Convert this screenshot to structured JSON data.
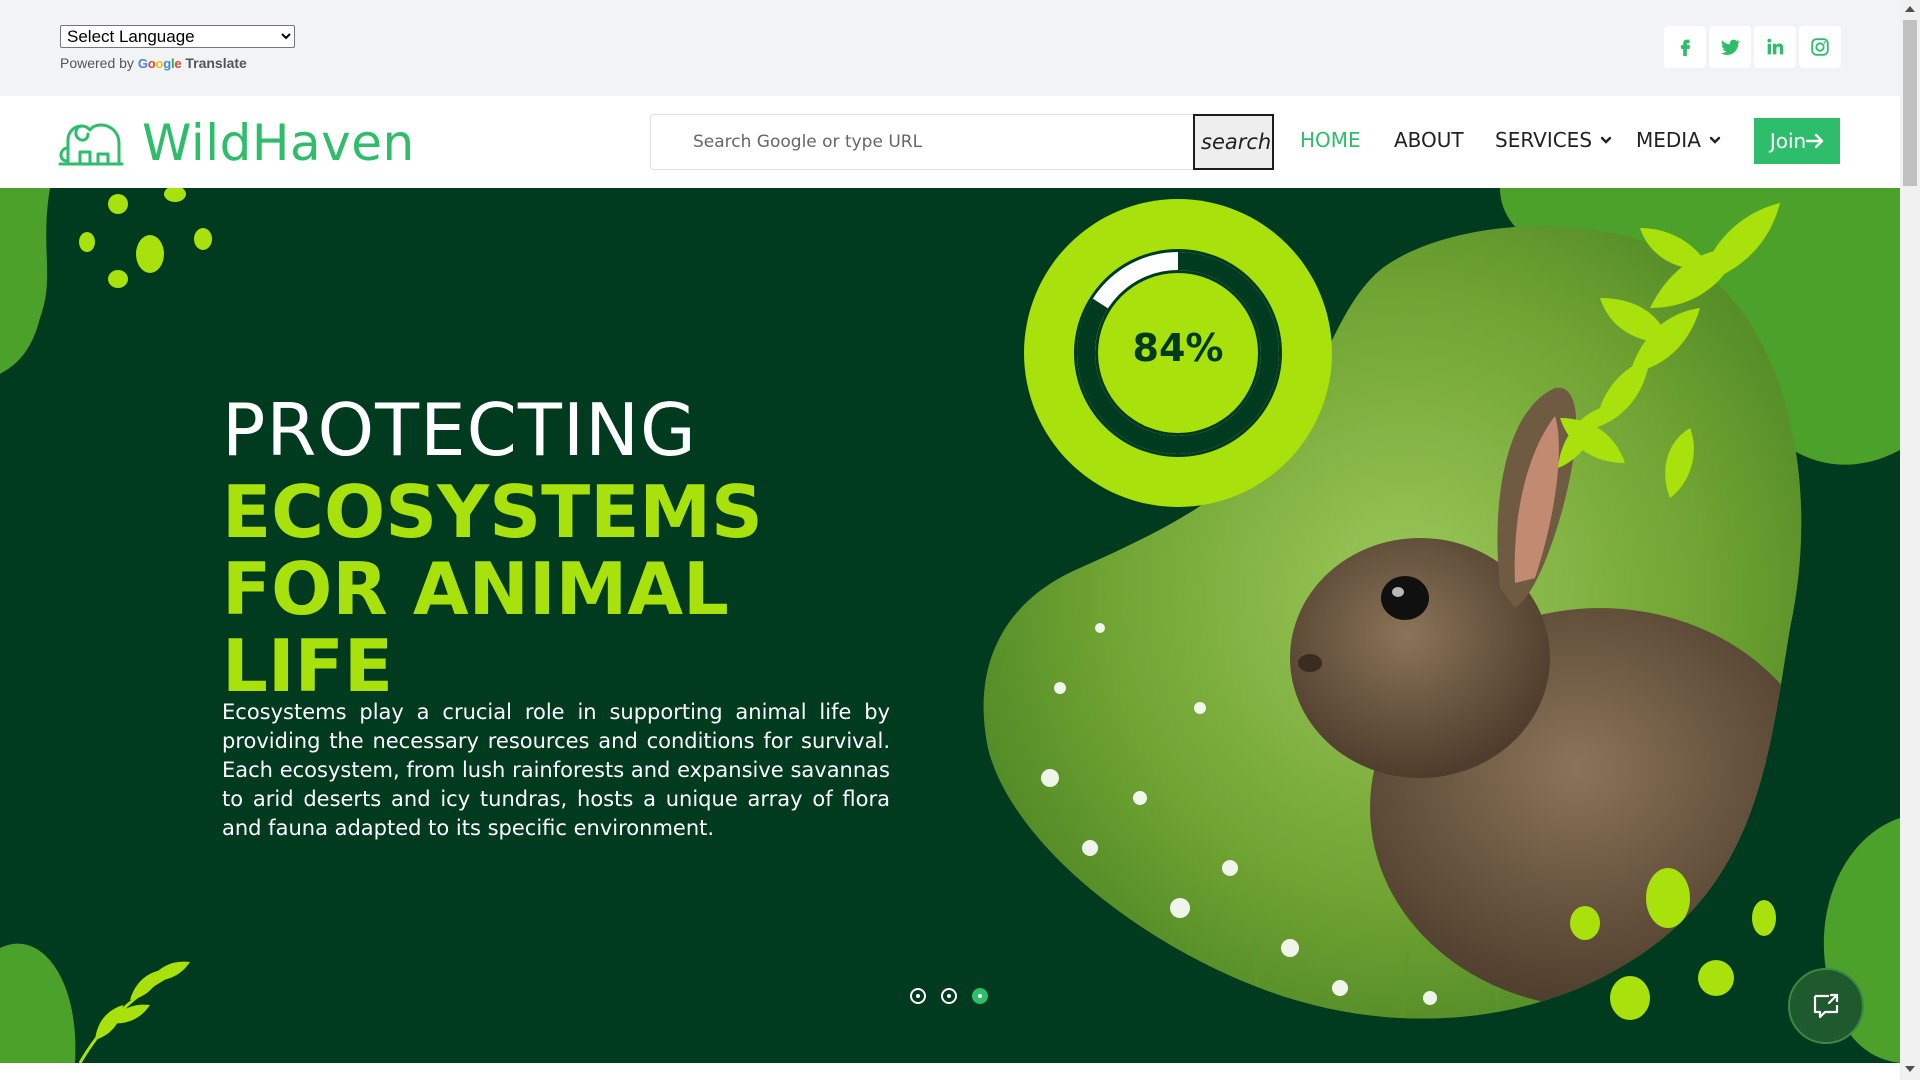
{
  "translate": {
    "select_label": "Select Language",
    "powered_by": "Powered by",
    "google_letters": [
      "G",
      "o",
      "o",
      "g",
      "l",
      "e"
    ],
    "translate_word": "Translate"
  },
  "social": [
    "facebook-icon",
    "twitter-icon",
    "linkedin-icon",
    "instagram-icon"
  ],
  "brand": {
    "name": "WildHaven",
    "color": "#2ebd6b"
  },
  "search": {
    "placeholder": "Search Google or type URL",
    "button": "search"
  },
  "nav": {
    "home": "HOME",
    "about": "ABOUT",
    "services": "SERVICES",
    "media": "MEDIA",
    "join": "Join"
  },
  "hero": {
    "title_line1": "PROTECTING",
    "title_line2": "ECOSYSTEMS FOR ANIMAL LIFE",
    "description": "Ecosystems play a crucial role in supporting animal life by providing the necessary resources and conditions for survival. Each ecosystem, from lush rainforests and expansive savannas to arid deserts and icy tundras, hosts a unique array of flora and fauna adapted to its specific environment.",
    "progress_label": "84%",
    "progress_value": 0.84,
    "slides": 3,
    "active_slide": 3
  },
  "colors": {
    "dark_green": "#003b1f",
    "lime": "#a8e10c",
    "accent": "#2ebd6b"
  }
}
